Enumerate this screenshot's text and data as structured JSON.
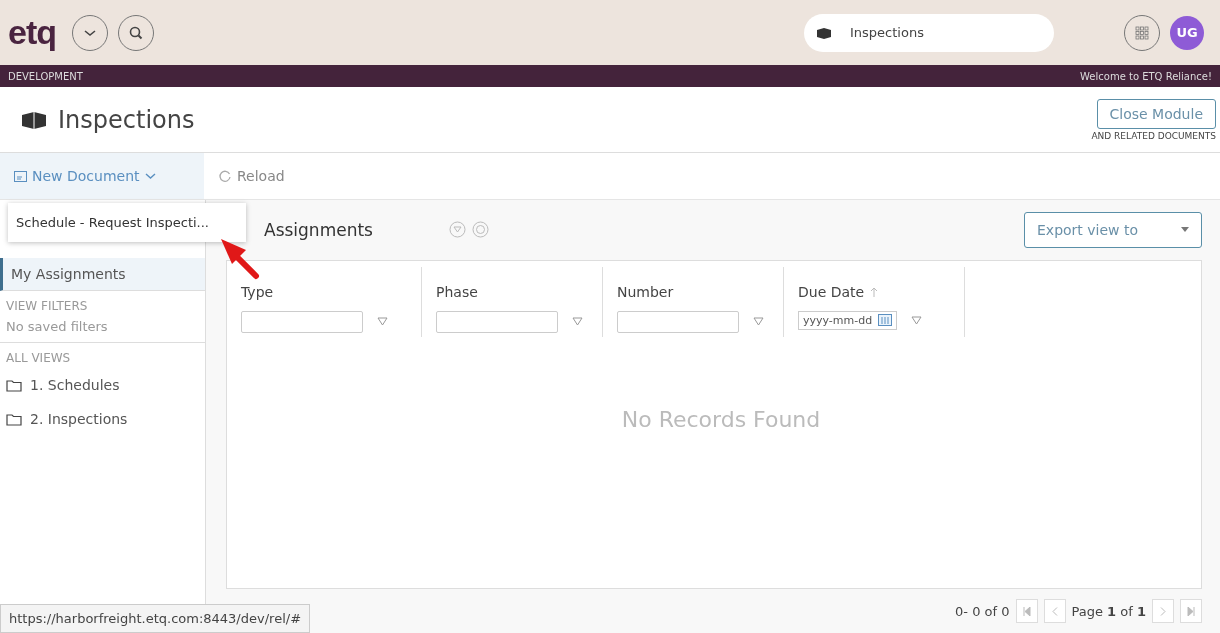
{
  "header": {
    "logo": "etq",
    "search_context": "Inspections",
    "avatar": "UG"
  },
  "banner": {
    "environment": "DEVELOPMENT",
    "welcome": "Welcome to ETQ Reliance!"
  },
  "module": {
    "title": "Inspections",
    "close_button": "Close Module",
    "close_note": "AND RELATED DOCUMENTS"
  },
  "toolbar": {
    "new_document": "New Document",
    "reload": "Reload"
  },
  "new_document_menu": {
    "expanded": true,
    "items": [
      "Schedule - Request Inspecti..."
    ]
  },
  "sidebar": {
    "items": [
      {
        "label": "My Assignments",
        "selected": true
      }
    ],
    "view_filters_heading": "VIEW FILTERS",
    "view_filters_empty": "No saved filters",
    "all_views_heading": "ALL VIEWS",
    "folders": [
      "1. Schedules",
      "2. Inspections"
    ]
  },
  "grid": {
    "title": "Assignments",
    "export": "Export view to",
    "columns": [
      {
        "label": "Type",
        "kind": "text"
      },
      {
        "label": "Phase",
        "kind": "text"
      },
      {
        "label": "Number",
        "kind": "text"
      },
      {
        "label": "Due Date",
        "kind": "date",
        "placeholder": "yyyy-mm-dd",
        "sorted": true
      }
    ],
    "empty": "No Records Found"
  },
  "pager": {
    "range": "0- 0 of 0",
    "page_label": "Page",
    "page": "1",
    "of": "of",
    "total": "1"
  },
  "status_url": "https://harborfreight.etq.com:8443/dev/rel/#"
}
